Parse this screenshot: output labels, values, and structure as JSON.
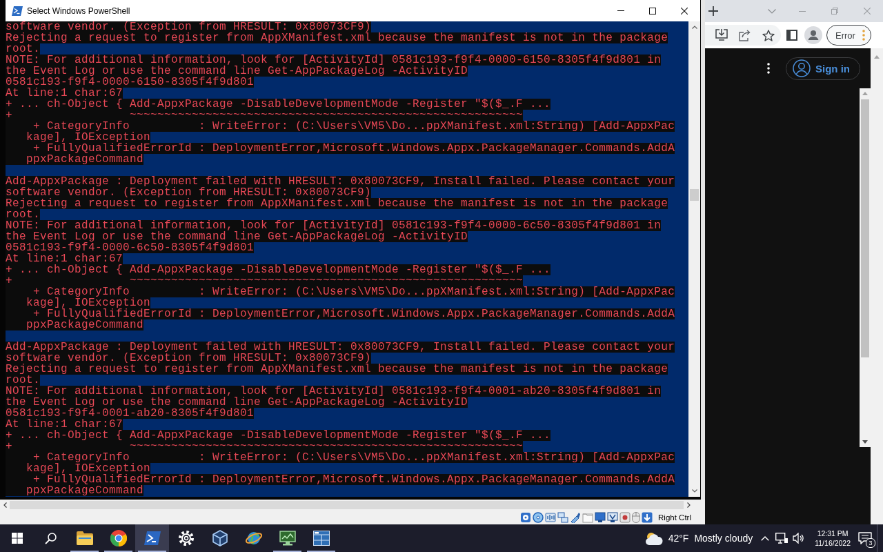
{
  "powershell_window": {
    "title": "Select Windows PowerShell",
    "lines": [
      {
        "kind": "text",
        "text": "software vendor. (Exception from HRESULT: 0x80073CF9)"
      },
      {
        "kind": "text",
        "text": "Rejecting a request to register from AppXManifest.xml because the manifest is not in the package"
      },
      {
        "kind": "text",
        "text": "root."
      },
      {
        "kind": "text",
        "text": "NOTE: For additional information, look for [ActivityId] 0581c193-f9f4-0000-6150-8305f4f9d801 in"
      },
      {
        "kind": "text",
        "text": "the Event Log or use the command line Get-AppPackageLog -ActivityID"
      },
      {
        "kind": "text",
        "text": "0581c193-f9f4-0000-6150-8305f4f9d801"
      },
      {
        "kind": "text",
        "text": "At line:1 char:67"
      },
      {
        "kind": "text",
        "text": "+ ... ch-Object { Add-AppxPackage -DisableDevelopmentMode -Register \"$($_.F ..."
      },
      {
        "kind": "text",
        "text": "+                 ~~~~~~~~~~~~~~~~~~~~~~~~~~~~~~~~~~~~~~~~~~~~~~~~~~~~~~~~~"
      },
      {
        "kind": "text",
        "text": "    + CategoryInfo          : WriteError: (C:\\Users\\VM5\\Do...ppXManifest.xml:String) [Add-AppxPac"
      },
      {
        "kind": "text",
        "text": "   kage], IOException"
      },
      {
        "kind": "text",
        "text": "    + FullyQualifiedErrorId : DeploymentError,Microsoft.Windows.Appx.PackageManager.Commands.AddA"
      },
      {
        "kind": "text",
        "text": "   ppxPackageCommand"
      },
      {
        "kind": "blank"
      },
      {
        "kind": "text",
        "text": "Add-AppxPackage : Deployment failed with HRESULT: 0x80073CF9, Install failed. Please contact your"
      },
      {
        "kind": "text",
        "text": "software vendor. (Exception from HRESULT: 0x80073CF9)"
      },
      {
        "kind": "text",
        "text": "Rejecting a request to register from AppXManifest.xml because the manifest is not in the package"
      },
      {
        "kind": "text",
        "text": "root."
      },
      {
        "kind": "text",
        "text": "NOTE: For additional information, look for [ActivityId] 0581c193-f9f4-0000-6c50-8305f4f9d801 in"
      },
      {
        "kind": "text",
        "text": "the Event Log or use the command line Get-AppPackageLog -ActivityID"
      },
      {
        "kind": "text",
        "text": "0581c193-f9f4-0000-6c50-8305f4f9d801"
      },
      {
        "kind": "text",
        "text": "At line:1 char:67"
      },
      {
        "kind": "text",
        "text": "+ ... ch-Object { Add-AppxPackage -DisableDevelopmentMode -Register \"$($_.F ..."
      },
      {
        "kind": "text",
        "text": "+                 ~~~~~~~~~~~~~~~~~~~~~~~~~~~~~~~~~~~~~~~~~~~~~~~~~~~~~~~~~"
      },
      {
        "kind": "text",
        "text": "    + CategoryInfo          : WriteError: (C:\\Users\\VM5\\Do...ppXManifest.xml:String) [Add-AppxPac"
      },
      {
        "kind": "text",
        "text": "   kage], IOException"
      },
      {
        "kind": "text",
        "text": "    + FullyQualifiedErrorId : DeploymentError,Microsoft.Windows.Appx.PackageManager.Commands.AddA"
      },
      {
        "kind": "text",
        "text": "   ppxPackageCommand"
      },
      {
        "kind": "blank"
      },
      {
        "kind": "text",
        "text": "Add-AppxPackage : Deployment failed with HRESULT: 0x80073CF9, Install failed. Please contact your"
      },
      {
        "kind": "text",
        "text": "software vendor. (Exception from HRESULT: 0x80073CF9)"
      },
      {
        "kind": "text",
        "text": "Rejecting a request to register from AppXManifest.xml because the manifest is not in the package"
      },
      {
        "kind": "text",
        "text": "root."
      },
      {
        "kind": "text",
        "text": "NOTE: For additional information, look for [ActivityId] 0581c193-f9f4-0001-ab20-8305f4f9d801 in"
      },
      {
        "kind": "text",
        "text": "the Event Log or use the command line Get-AppPackageLog -ActivityID"
      },
      {
        "kind": "text",
        "text": "0581c193-f9f4-0001-ab20-8305f4f9d801"
      },
      {
        "kind": "text",
        "text": "At line:1 char:67"
      },
      {
        "kind": "text",
        "text": "+ ... ch-Object { Add-AppxPackage -DisableDevelopmentMode -Register \"$($_.F ..."
      },
      {
        "kind": "text",
        "text": "+                 ~~~~~~~~~~~~~~~~~~~~~~~~~~~~~~~~~~~~~~~~~~~~~~~~~~~~~~~~~"
      },
      {
        "kind": "text",
        "text": "    + CategoryInfo          : WriteError: (C:\\Users\\VM5\\Do...ppXManifest.xml:String) [Add-AppxPac"
      },
      {
        "kind": "text",
        "text": "   kage], IOException"
      },
      {
        "kind": "text",
        "text": "    + FullyQualifiedErrorId : DeploymentError,Microsoft.Windows.Appx.PackageManager.Commands.AddA"
      },
      {
        "kind": "text",
        "text": "   ppxPackageCommand"
      }
    ]
  },
  "vm_status_bar": {
    "host_key": "Right Ctrl"
  },
  "browser": {
    "profile_status": "Error",
    "sign_in_button": "Sign in"
  },
  "taskbar": {
    "apps": [
      {
        "kind": "folder",
        "running": true,
        "selected": false
      },
      {
        "kind": "browser",
        "running": true,
        "selected": false
      },
      {
        "kind": "terminal",
        "running": true,
        "selected": true
      },
      {
        "kind": "gear",
        "running": false,
        "selected": false
      },
      {
        "kind": "cube",
        "running": false,
        "selected": false
      },
      {
        "kind": "globe",
        "running": false,
        "selected": false
      },
      {
        "kind": "monitor",
        "running": true,
        "selected": false
      },
      {
        "kind": "tile",
        "running": true,
        "selected": false
      }
    ],
    "weather": {
      "temperature": "42°F",
      "condition": "Mostly cloudy"
    },
    "clock": {
      "time": "12:31 PM",
      "date": "11/16/2022"
    },
    "notification_count": "3"
  }
}
